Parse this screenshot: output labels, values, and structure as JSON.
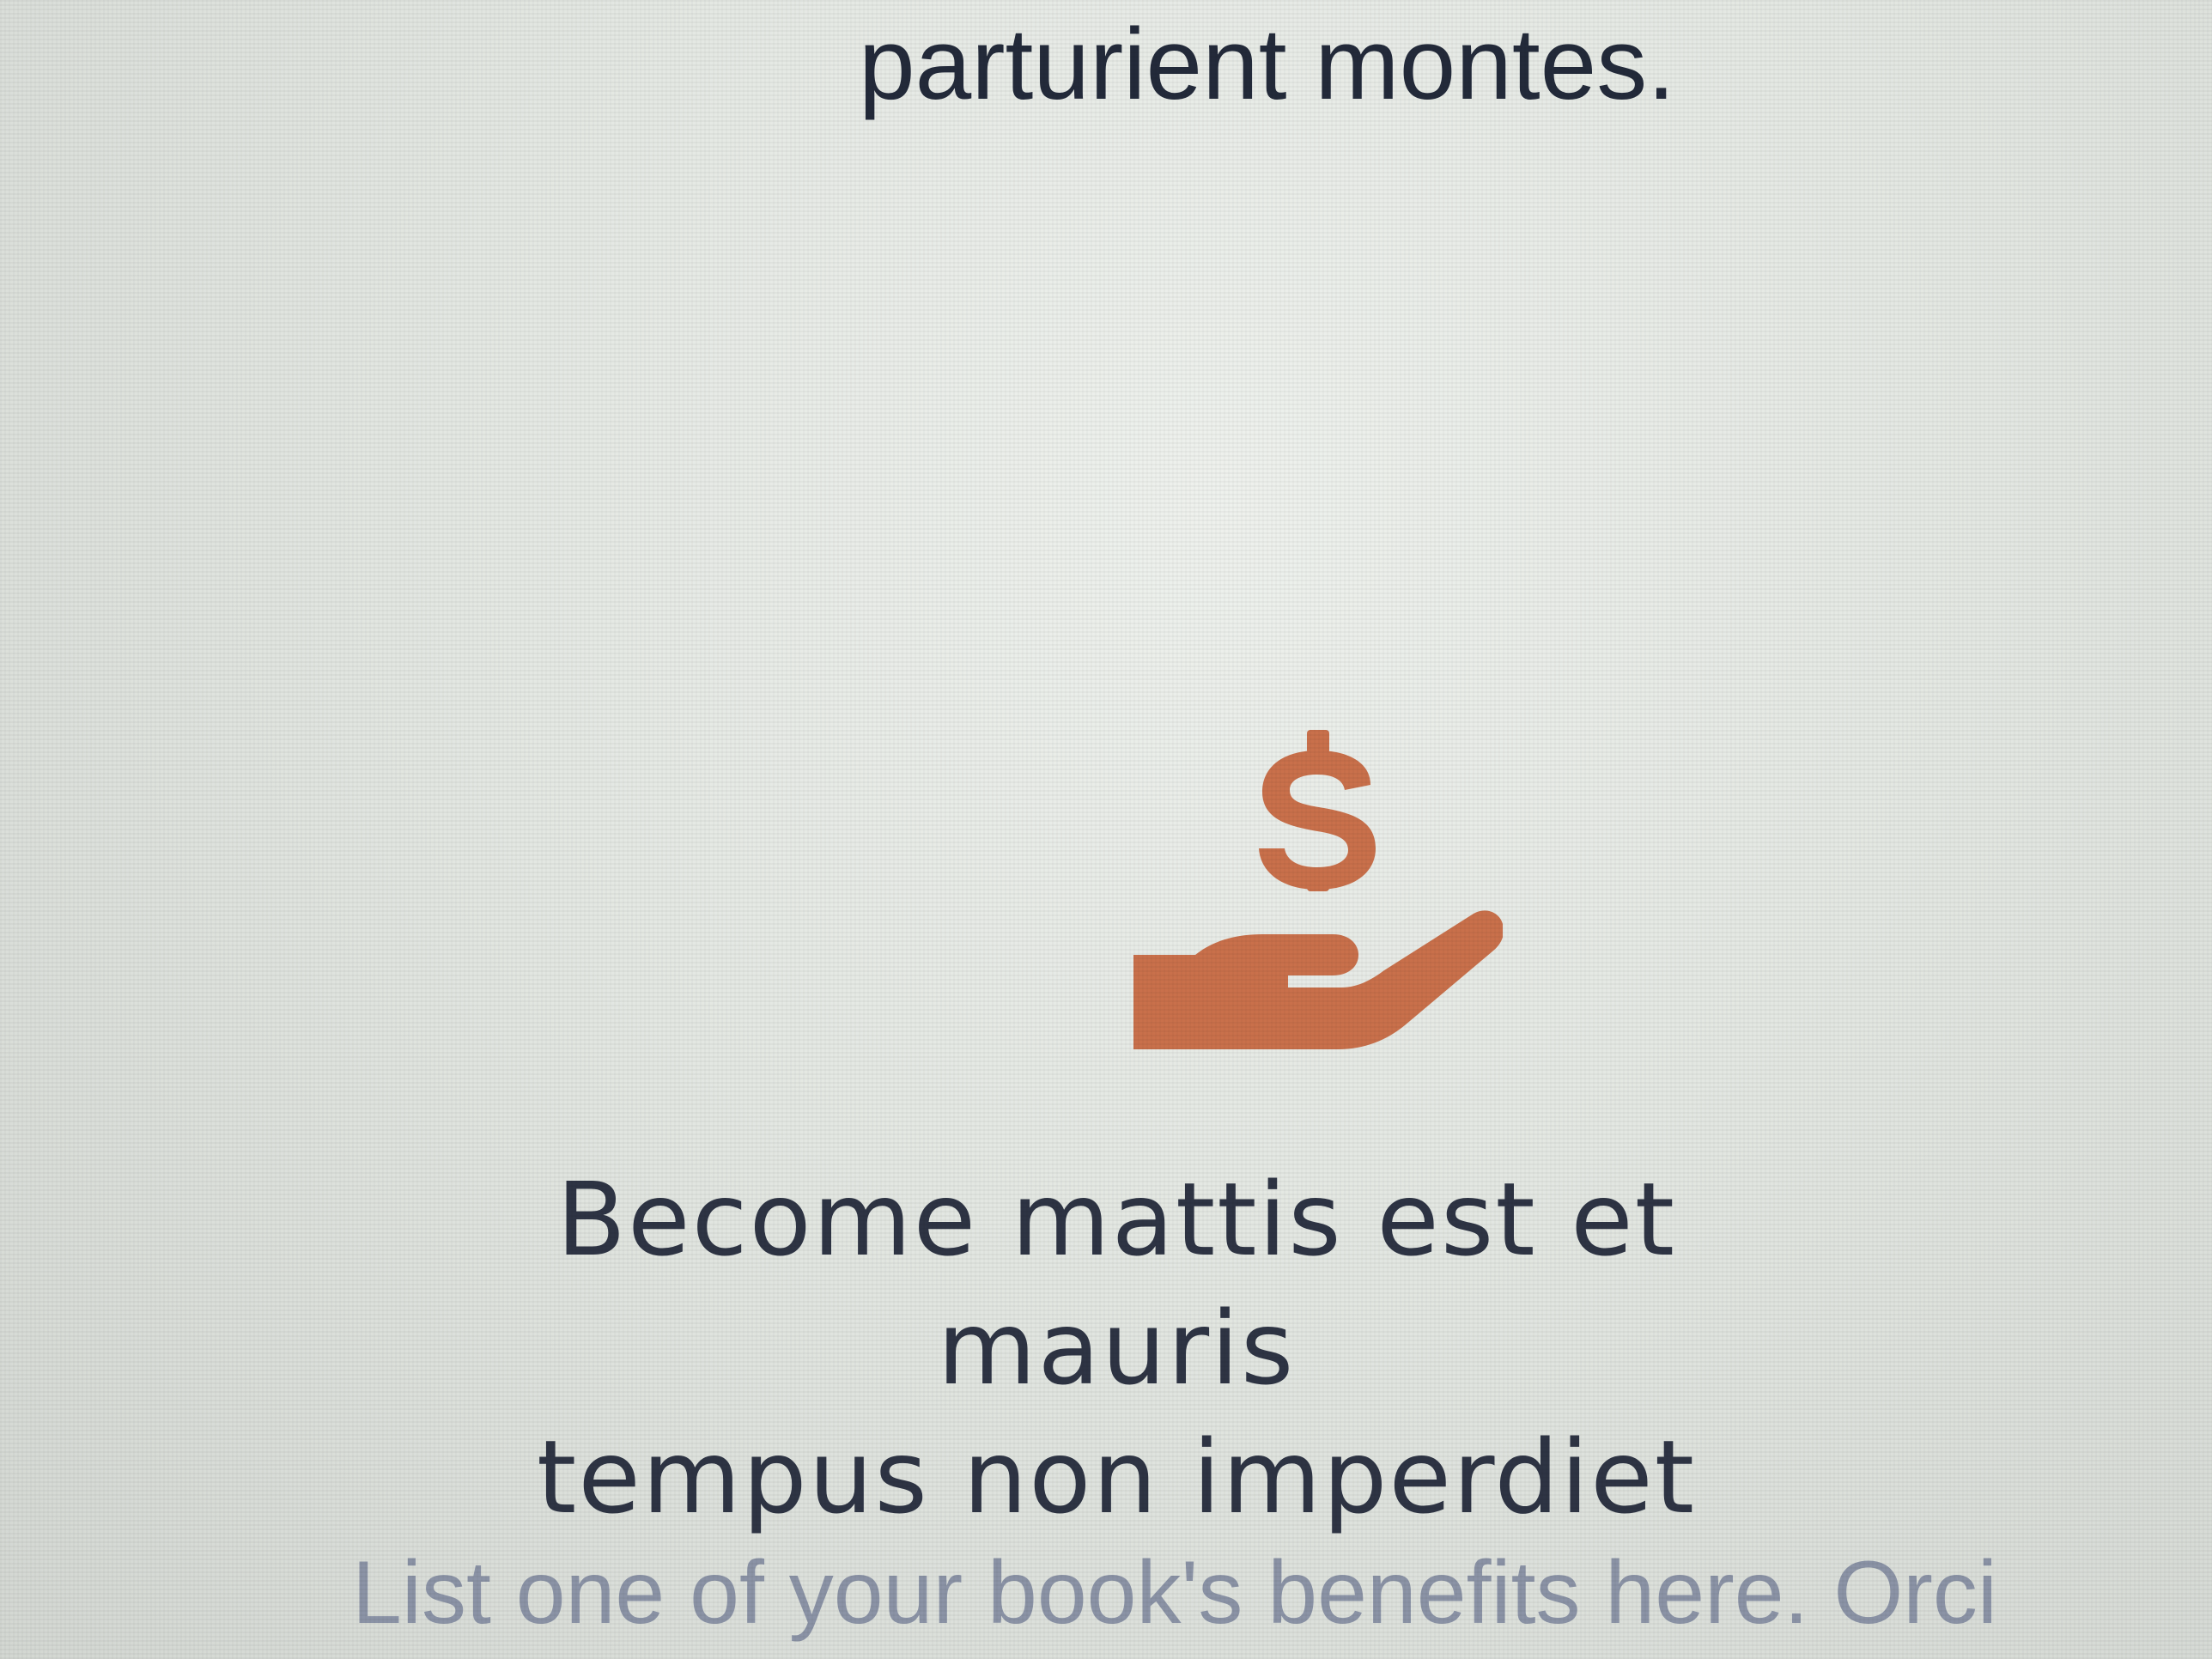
{
  "content": {
    "top_text": "parturient montes.",
    "icon": "hand-holding-dollar-icon",
    "accent_color": "#c9704b",
    "heading_line1": "Become mattis est et mauris",
    "heading_line2": "tempus non imperdiet",
    "body_text": "List one of your book's benefits here. Orci"
  }
}
